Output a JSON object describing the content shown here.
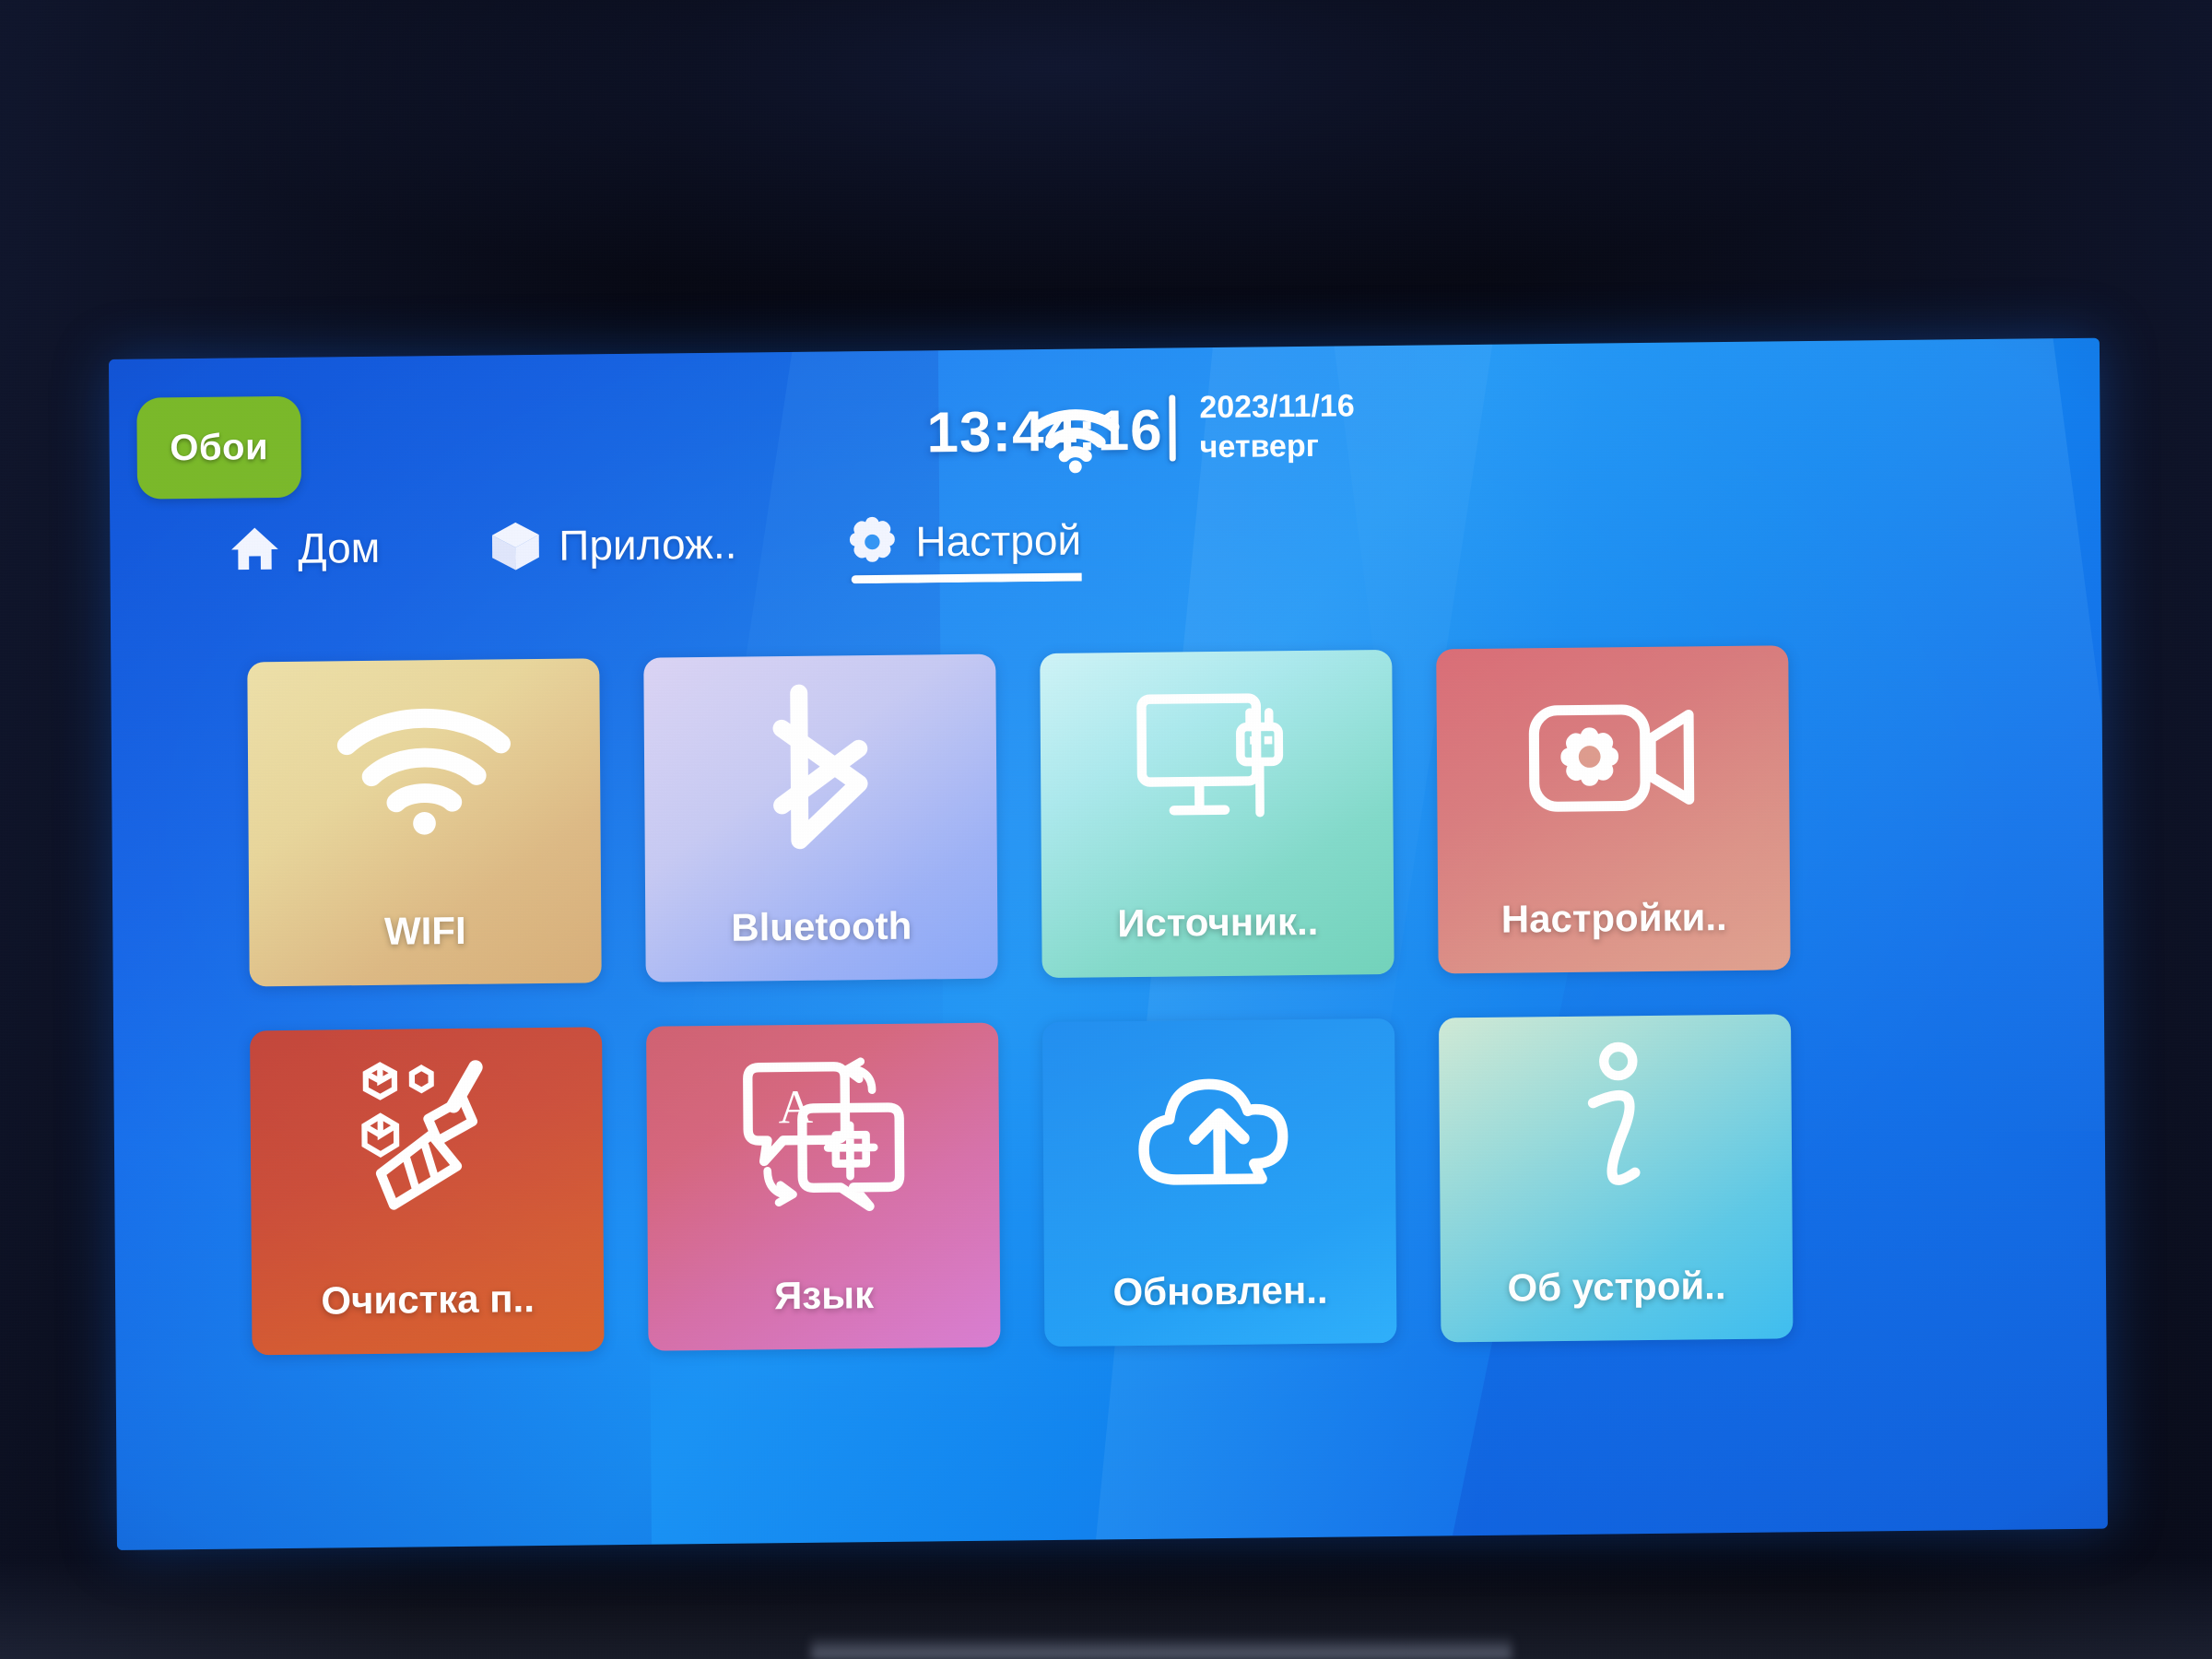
{
  "statusbar": {
    "wallpaper_button": "Обои",
    "clock": "13:44:16",
    "wifi_icon": "wifi-icon",
    "date": "2023/11/16",
    "weekday": "четверг"
  },
  "nav": {
    "tabs": [
      {
        "label": "Дом",
        "icon": "home-icon",
        "active": false
      },
      {
        "label": "Прилож..",
        "icon": "cube-icon",
        "active": false
      },
      {
        "label": "Настрой",
        "icon": "gear-icon",
        "active": true
      }
    ]
  },
  "tiles": [
    {
      "label": "WIFI",
      "icon": "wifi-icon",
      "color": "#e0cd92"
    },
    {
      "label": "Bluetooth",
      "icon": "bluetooth-icon",
      "color": "#b0b8f5"
    },
    {
      "label": "Источник..",
      "icon": "display-input-icon",
      "color": "#8ee0d5"
    },
    {
      "label": "Настройки..",
      "icon": "video-settings-icon",
      "color": "#dc8a83"
    },
    {
      "label": "Очистка п..",
      "icon": "broom-icon",
      "color": "#cf5335"
    },
    {
      "label": "Язык",
      "icon": "translate-icon",
      "color": "#d46ca6"
    },
    {
      "label": "Обновлен..",
      "icon": "cloud-upload-icon",
      "color": "#22a0f6"
    },
    {
      "label": "Об устрой..",
      "icon": "info-icon",
      "color": "#72cce5"
    }
  ],
  "colors": {
    "screen_blue": "#1a86f2",
    "accent_green": "#7ab92a",
    "text_white": "#ffffff",
    "bezel_black": "#05060e"
  }
}
